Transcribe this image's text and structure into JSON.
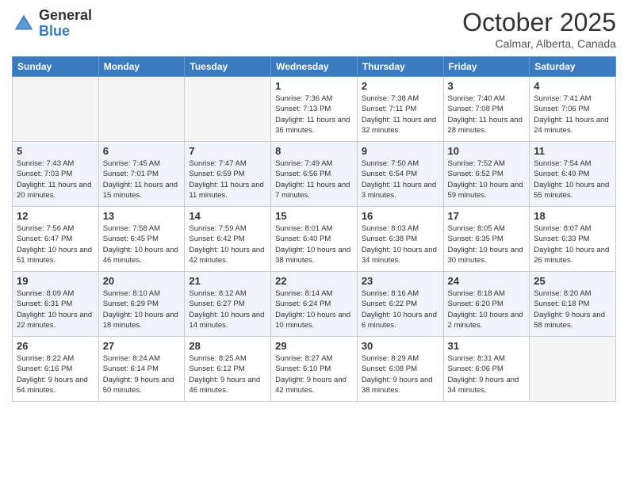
{
  "logo": {
    "general": "General",
    "blue": "Blue"
  },
  "title": "October 2025",
  "subtitle": "Calmar, Alberta, Canada",
  "days_header": [
    "Sunday",
    "Monday",
    "Tuesday",
    "Wednesday",
    "Thursday",
    "Friday",
    "Saturday"
  ],
  "weeks": [
    [
      {
        "day": "",
        "sunrise": "",
        "sunset": "",
        "daylight": "",
        "empty": true
      },
      {
        "day": "",
        "sunrise": "",
        "sunset": "",
        "daylight": "",
        "empty": true
      },
      {
        "day": "",
        "sunrise": "",
        "sunset": "",
        "daylight": "",
        "empty": true
      },
      {
        "day": "1",
        "sunrise": "Sunrise: 7:36 AM",
        "sunset": "Sunset: 7:13 PM",
        "daylight": "Daylight: 11 hours and 36 minutes.",
        "empty": false
      },
      {
        "day": "2",
        "sunrise": "Sunrise: 7:38 AM",
        "sunset": "Sunset: 7:11 PM",
        "daylight": "Daylight: 11 hours and 32 minutes.",
        "empty": false
      },
      {
        "day": "3",
        "sunrise": "Sunrise: 7:40 AM",
        "sunset": "Sunset: 7:08 PM",
        "daylight": "Daylight: 11 hours and 28 minutes.",
        "empty": false
      },
      {
        "day": "4",
        "sunrise": "Sunrise: 7:41 AM",
        "sunset": "Sunset: 7:06 PM",
        "daylight": "Daylight: 11 hours and 24 minutes.",
        "empty": false
      }
    ],
    [
      {
        "day": "5",
        "sunrise": "Sunrise: 7:43 AM",
        "sunset": "Sunset: 7:03 PM",
        "daylight": "Daylight: 11 hours and 20 minutes.",
        "empty": false
      },
      {
        "day": "6",
        "sunrise": "Sunrise: 7:45 AM",
        "sunset": "Sunset: 7:01 PM",
        "daylight": "Daylight: 11 hours and 15 minutes.",
        "empty": false
      },
      {
        "day": "7",
        "sunrise": "Sunrise: 7:47 AM",
        "sunset": "Sunset: 6:59 PM",
        "daylight": "Daylight: 11 hours and 11 minutes.",
        "empty": false
      },
      {
        "day": "8",
        "sunrise": "Sunrise: 7:49 AM",
        "sunset": "Sunset: 6:56 PM",
        "daylight": "Daylight: 11 hours and 7 minutes.",
        "empty": false
      },
      {
        "day": "9",
        "sunrise": "Sunrise: 7:50 AM",
        "sunset": "Sunset: 6:54 PM",
        "daylight": "Daylight: 11 hours and 3 minutes.",
        "empty": false
      },
      {
        "day": "10",
        "sunrise": "Sunrise: 7:52 AM",
        "sunset": "Sunset: 6:52 PM",
        "daylight": "Daylight: 10 hours and 59 minutes.",
        "empty": false
      },
      {
        "day": "11",
        "sunrise": "Sunrise: 7:54 AM",
        "sunset": "Sunset: 6:49 PM",
        "daylight": "Daylight: 10 hours and 55 minutes.",
        "empty": false
      }
    ],
    [
      {
        "day": "12",
        "sunrise": "Sunrise: 7:56 AM",
        "sunset": "Sunset: 6:47 PM",
        "daylight": "Daylight: 10 hours and 51 minutes.",
        "empty": false
      },
      {
        "day": "13",
        "sunrise": "Sunrise: 7:58 AM",
        "sunset": "Sunset: 6:45 PM",
        "daylight": "Daylight: 10 hours and 46 minutes.",
        "empty": false
      },
      {
        "day": "14",
        "sunrise": "Sunrise: 7:59 AM",
        "sunset": "Sunset: 6:42 PM",
        "daylight": "Daylight: 10 hours and 42 minutes.",
        "empty": false
      },
      {
        "day": "15",
        "sunrise": "Sunrise: 8:01 AM",
        "sunset": "Sunset: 6:40 PM",
        "daylight": "Daylight: 10 hours and 38 minutes.",
        "empty": false
      },
      {
        "day": "16",
        "sunrise": "Sunrise: 8:03 AM",
        "sunset": "Sunset: 6:38 PM",
        "daylight": "Daylight: 10 hours and 34 minutes.",
        "empty": false
      },
      {
        "day": "17",
        "sunrise": "Sunrise: 8:05 AM",
        "sunset": "Sunset: 6:35 PM",
        "daylight": "Daylight: 10 hours and 30 minutes.",
        "empty": false
      },
      {
        "day": "18",
        "sunrise": "Sunrise: 8:07 AM",
        "sunset": "Sunset: 6:33 PM",
        "daylight": "Daylight: 10 hours and 26 minutes.",
        "empty": false
      }
    ],
    [
      {
        "day": "19",
        "sunrise": "Sunrise: 8:09 AM",
        "sunset": "Sunset: 6:31 PM",
        "daylight": "Daylight: 10 hours and 22 minutes.",
        "empty": false
      },
      {
        "day": "20",
        "sunrise": "Sunrise: 8:10 AM",
        "sunset": "Sunset: 6:29 PM",
        "daylight": "Daylight: 10 hours and 18 minutes.",
        "empty": false
      },
      {
        "day": "21",
        "sunrise": "Sunrise: 8:12 AM",
        "sunset": "Sunset: 6:27 PM",
        "daylight": "Daylight: 10 hours and 14 minutes.",
        "empty": false
      },
      {
        "day": "22",
        "sunrise": "Sunrise: 8:14 AM",
        "sunset": "Sunset: 6:24 PM",
        "daylight": "Daylight: 10 hours and 10 minutes.",
        "empty": false
      },
      {
        "day": "23",
        "sunrise": "Sunrise: 8:16 AM",
        "sunset": "Sunset: 6:22 PM",
        "daylight": "Daylight: 10 hours and 6 minutes.",
        "empty": false
      },
      {
        "day": "24",
        "sunrise": "Sunrise: 8:18 AM",
        "sunset": "Sunset: 6:20 PM",
        "daylight": "Daylight: 10 hours and 2 minutes.",
        "empty": false
      },
      {
        "day": "25",
        "sunrise": "Sunrise: 8:20 AM",
        "sunset": "Sunset: 6:18 PM",
        "daylight": "Daylight: 9 hours and 58 minutes.",
        "empty": false
      }
    ],
    [
      {
        "day": "26",
        "sunrise": "Sunrise: 8:22 AM",
        "sunset": "Sunset: 6:16 PM",
        "daylight": "Daylight: 9 hours and 54 minutes.",
        "empty": false
      },
      {
        "day": "27",
        "sunrise": "Sunrise: 8:24 AM",
        "sunset": "Sunset: 6:14 PM",
        "daylight": "Daylight: 9 hours and 50 minutes.",
        "empty": false
      },
      {
        "day": "28",
        "sunrise": "Sunrise: 8:25 AM",
        "sunset": "Sunset: 6:12 PM",
        "daylight": "Daylight: 9 hours and 46 minutes.",
        "empty": false
      },
      {
        "day": "29",
        "sunrise": "Sunrise: 8:27 AM",
        "sunset": "Sunset: 6:10 PM",
        "daylight": "Daylight: 9 hours and 42 minutes.",
        "empty": false
      },
      {
        "day": "30",
        "sunrise": "Sunrise: 8:29 AM",
        "sunset": "Sunset: 6:08 PM",
        "daylight": "Daylight: 9 hours and 38 minutes.",
        "empty": false
      },
      {
        "day": "31",
        "sunrise": "Sunrise: 8:31 AM",
        "sunset": "Sunset: 6:06 PM",
        "daylight": "Daylight: 9 hours and 34 minutes.",
        "empty": false
      },
      {
        "day": "",
        "sunrise": "",
        "sunset": "",
        "daylight": "",
        "empty": true
      }
    ]
  ]
}
